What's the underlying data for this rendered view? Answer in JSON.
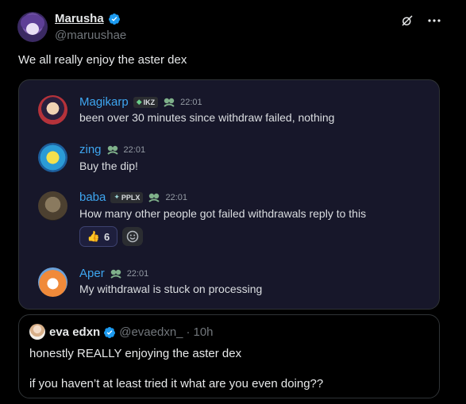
{
  "post": {
    "display_name": "Marusha",
    "handle": "@maruushae",
    "text": "We all really enjoy the aster dex"
  },
  "discord": {
    "messages": [
      {
        "user": "Magikarp",
        "tag": "IKZ",
        "time": "22:01",
        "text": "been over 30 minutes since withdraw failed, nothing"
      },
      {
        "user": "zing",
        "time": "22:01",
        "text": "Buy the dip!"
      },
      {
        "user": "baba",
        "tag": "PPLX",
        "time": "22:01",
        "text": "How many other people got failed withdrawals reply to this",
        "reaction": {
          "emoji": "👍",
          "count": "6"
        }
      },
      {
        "user": "Aper",
        "time": "22:01",
        "text": "My withdrawal is stuck on processing"
      }
    ]
  },
  "quote": {
    "display_name": "eva edxn",
    "handle": "@evaedxn_",
    "separator": "·",
    "age": "10h",
    "line1": "honestly REALLY enjoying the aster dex",
    "line2": "if you haven’t at least tried it what are you even doing??"
  },
  "colors": {
    "link_blue": "#3ea6f0",
    "verified_blue": "#1d9bf0",
    "card_bg": "#17172a"
  },
  "icons": [
    "verified-icon",
    "grok-icon",
    "more-icon",
    "role-icon",
    "add-reaction-icon"
  ]
}
